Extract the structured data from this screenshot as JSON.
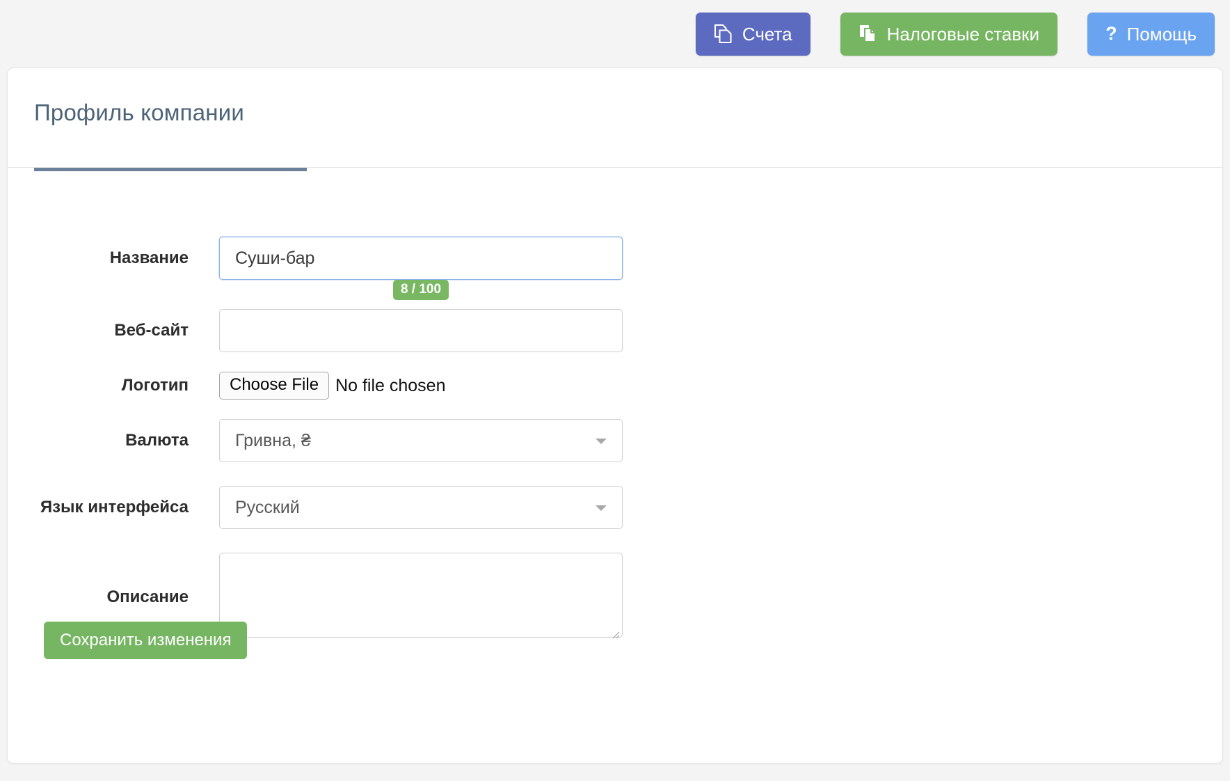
{
  "toolbar": {
    "buttons": [
      {
        "label": "Счета",
        "icon": "copy-documents-icon",
        "color": "#5c6bc0"
      },
      {
        "label": "Налоговые ставки",
        "icon": "file-document-icon",
        "color": "#76b562"
      },
      {
        "label": "Помощь",
        "icon": "question-mark-icon",
        "color": "#6aa3ef"
      }
    ]
  },
  "card": {
    "title": "Профиль компании",
    "active_tab_accent": "#6b809b"
  },
  "form": {
    "name": {
      "label": "Название",
      "value": "Суши-бар",
      "placeholder": "",
      "counter": "8 / 100",
      "counter_color": "#79b763",
      "focused": true
    },
    "website": {
      "label": "Веб-сайт",
      "value": "",
      "placeholder": ""
    },
    "logo": {
      "label": "Логотип",
      "button_label": "Choose File",
      "status_text": "No file chosen"
    },
    "currency": {
      "label": "Валюта",
      "value": "Гривна, ₴",
      "options": [
        "Гривна, ₴"
      ]
    },
    "language": {
      "label": "Язык интерфейса",
      "value": "Русский",
      "options": [
        "Русский"
      ]
    },
    "description": {
      "label": "Описание",
      "value": "",
      "placeholder": ""
    },
    "submit": {
      "label": "Сохранить изменения",
      "color": "#76b562"
    }
  }
}
